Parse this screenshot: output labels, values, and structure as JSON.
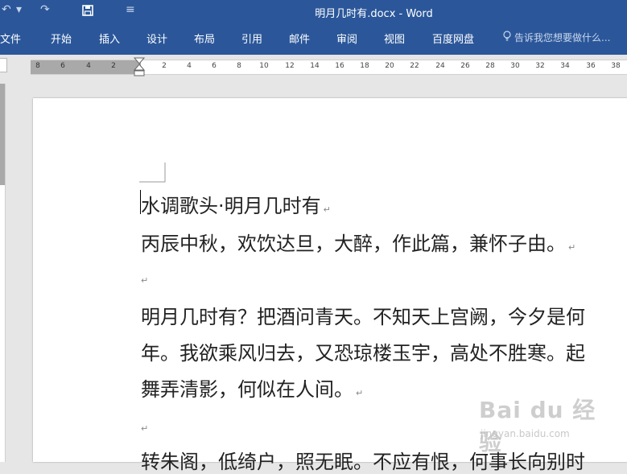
{
  "title_bar": {
    "window_title": "明月几时有.docx - Word",
    "undo_icon": "↶",
    "undo_dropdown": "▾",
    "redo_icon": "↷",
    "customize_icon": "≡"
  },
  "ribbon": {
    "tabs": [
      "文件",
      "开始",
      "插入",
      "设计",
      "布局",
      "引用",
      "邮件",
      "审阅",
      "视图",
      "百度网盘"
    ],
    "tell_me": "告诉我您想要做什么..."
  },
  "ruler": {
    "ticks": [
      "8",
      "6",
      "4",
      "2",
      "2",
      "4",
      "6",
      "8",
      "10",
      "12",
      "14",
      "16",
      "18",
      "20",
      "22",
      "24",
      "26",
      "28",
      "30",
      "32",
      "34",
      "36",
      "38"
    ]
  },
  "document": {
    "lines": [
      {
        "text": "水调歌头·明月几时有",
        "mark": "↵"
      },
      {
        "text": "丙辰中秋，欢饮达旦，大醉，作此篇，兼怀子由。",
        "mark": "↵"
      },
      {
        "text": "",
        "mark": "↵"
      },
      {
        "text": "明月几时有？把酒问青天。不知天上宫阙，今夕是何",
        "mark": ""
      },
      {
        "text": "年。我欲乘风归去，又恐琼楼玉宇，高处不胜寒。起",
        "mark": ""
      },
      {
        "text": "舞弄清影，何似在人间。",
        "mark": "↵"
      },
      {
        "text": "",
        "mark": "↵"
      },
      {
        "text": "转朱阁，低绮户，照无眠。不应有恨，何事长向别时",
        "mark": ""
      }
    ]
  },
  "watermark": {
    "brand": "Bai du 经验",
    "url": "jingyan.baidu.com"
  },
  "colors": {
    "ribbon_blue": "#2b579a",
    "ruler_margin": "#a9a9a9",
    "background": "#e6e6e6"
  }
}
